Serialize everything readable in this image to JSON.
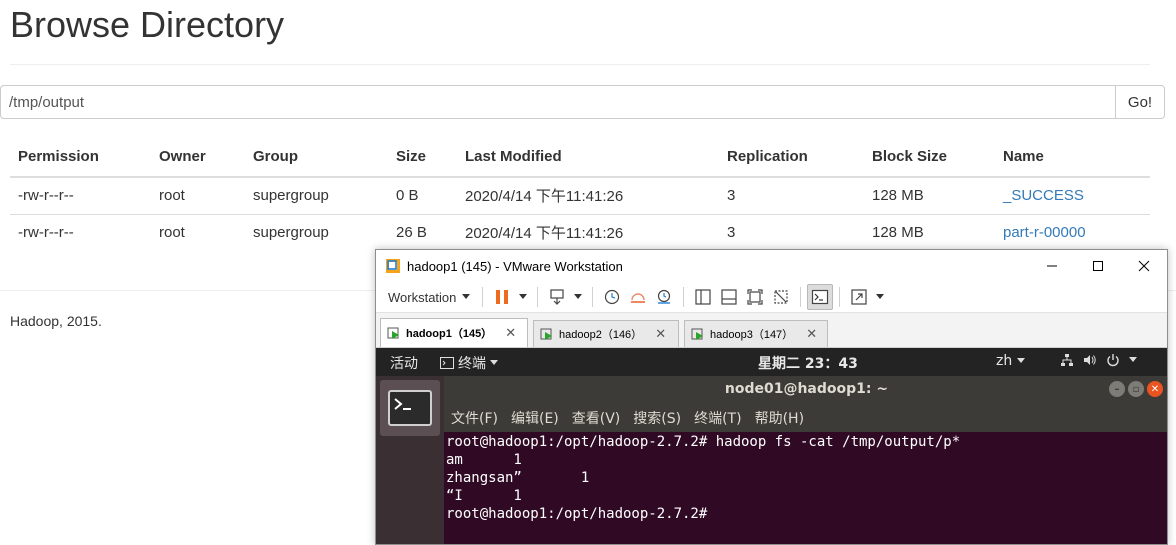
{
  "page": {
    "title": "Browse Directory",
    "path": "/tmp/output",
    "go_label": "Go!",
    "footer": "Hadoop, 2015."
  },
  "table": {
    "headers": [
      "Permission",
      "Owner",
      "Group",
      "Size",
      "Last Modified",
      "Replication",
      "Block Size",
      "Name"
    ],
    "rows": [
      [
        "-rw-r--r--",
        "root",
        "supergroup",
        "0 B",
        "2020/4/14 下午11:41:26",
        "3",
        "128 MB",
        "_SUCCESS"
      ],
      [
        "-rw-r--r--",
        "root",
        "supergroup",
        "26 B",
        "2020/4/14 下午11:41:26",
        "3",
        "128 MB",
        "part-r-00000"
      ]
    ]
  },
  "vmware": {
    "window_title": "hadoop1  (145)   - VMware Workstation",
    "menu_label": "Workstation",
    "tabs": [
      {
        "label": "hadoop1（145）"
      },
      {
        "label": "hadoop2（146）"
      },
      {
        "label": "hadoop3（147）"
      }
    ],
    "colors": {
      "pause": "#ee6a1f",
      "accent": "#1f7fd6"
    }
  },
  "guest": {
    "activities": "活动",
    "app_menu": "终端",
    "clock": "星期二 23：43",
    "input_method": "zh",
    "terminal_title": "node01@hadoop1: ~",
    "menu": [
      "文件(F)",
      "编辑(E)",
      "查看(V)",
      "搜索(S)",
      "终端(T)",
      "帮助(H)"
    ],
    "lines": [
      "root@hadoop1:/opt/hadoop-2.7.2# hadoop fs -cat /tmp/output/p*",
      "am      1",
      "zhangsan”       1",
      "“I      1",
      "root@hadoop1:/opt/hadoop-2.7.2#"
    ],
    "colors": {
      "terminal_bg": "#300a24",
      "ubuntu_orange": "#e95420"
    }
  }
}
